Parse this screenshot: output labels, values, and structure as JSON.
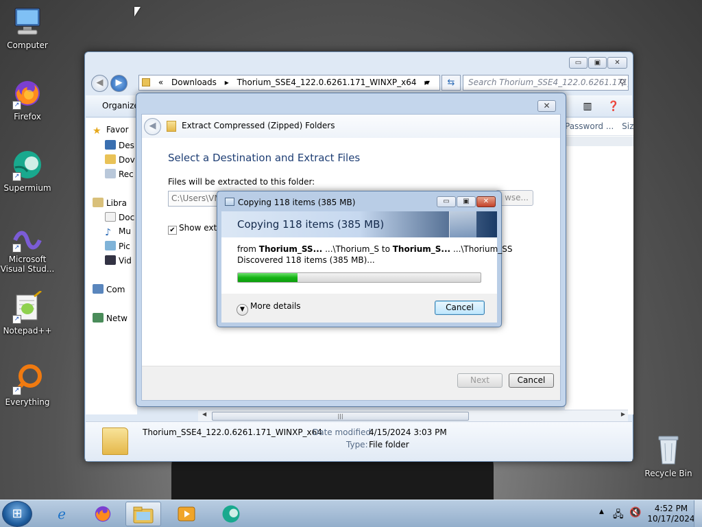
{
  "desktop": {
    "icons": [
      {
        "label": "Computer"
      },
      {
        "label": "Firefox"
      },
      {
        "label": "Supermium"
      },
      {
        "label": "Microsoft Visual Stud..."
      },
      {
        "label": "Notepad++"
      },
      {
        "label": "Everything"
      },
      {
        "label": "Recycle Bin"
      }
    ]
  },
  "explorer": {
    "breadcrumb": [
      "«",
      "Downloads",
      "▸",
      "Thorium_SSE4_122.0.6261.171_WINXP_x64",
      "▸"
    ],
    "search_placeholder": "Search Thorium_SSE4_122.0.6261.171_...",
    "toolbar": {
      "organize": "Organize"
    },
    "nav": {
      "favorites": "Favor",
      "desktop": "Des",
      "downloads": "Dov",
      "recent": "Rec",
      "libraries": "Libra",
      "documents": "Doc",
      "music": "Mu",
      "pictures": "Pic",
      "videos": "Vid",
      "computer": "Com",
      "network": "Netw"
    },
    "columns": {
      "password": "Password ...",
      "size": "Siz"
    },
    "details": {
      "name": "Thorium_SSE4_122.0.6261.171_WINXP_x64",
      "modified_label": "Date modified:",
      "modified_value": "4/15/2024 3:03 PM",
      "type_label": "Type:",
      "type_value": "File folder"
    }
  },
  "extract_wizard": {
    "title": "Extract Compressed (Zipped) Folders",
    "heading": "Select a Destination and Extract Files",
    "folder_label": "Files will be extracted to this folder:",
    "path_value": "C:\\Users\\VMI",
    "browse_label": "wse...",
    "show_check_label": "Show extra",
    "show_checked": true,
    "next_label": "Next",
    "cancel_label": "Cancel"
  },
  "copy_dialog": {
    "title": "Copying 118 items (385 MB)",
    "banner": "Copying 118 items (385 MB)",
    "from_word": "from",
    "from_name": "Thorium_SS...",
    "from_path": "...\\Thorium_S",
    "to_word": "to",
    "to_name": "Thorium_S...",
    "to_path": "...\\Thorium_SS",
    "discovered": "Discovered 118 items (385 MB)...",
    "progress": 0.245,
    "more_details": "More details",
    "cancel_label": "Cancel"
  },
  "taskbar": {
    "time": "4:52 PM",
    "date": "10/17/2024"
  },
  "colors": {
    "progress_green": "#15b315",
    "wizard_heading": "#1e3e74",
    "taskbar": "#a9c1dc"
  }
}
